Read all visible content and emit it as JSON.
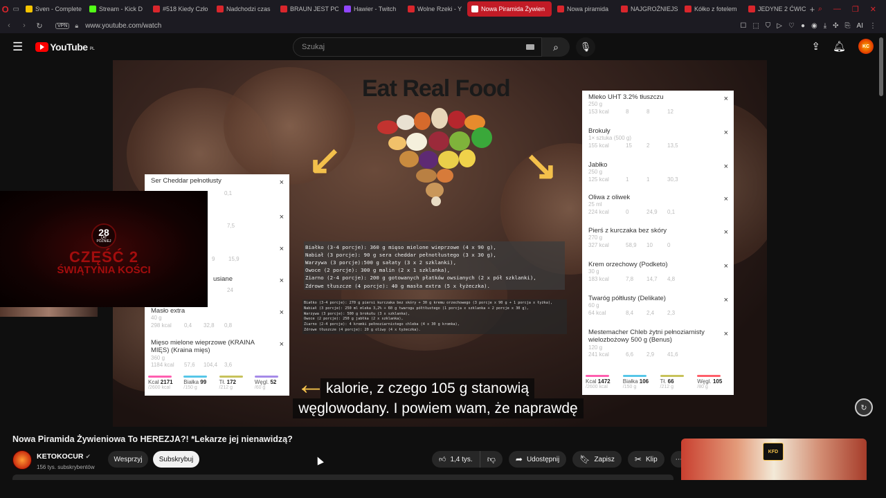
{
  "browser": {
    "tabs": [
      {
        "label": "Sven - Complete",
        "color": "#f5c400"
      },
      {
        "label": "Stream - Kick D",
        "color": "#53fc18"
      },
      {
        "label": "#518 Kiedy Czło",
        "color": "#d9262c"
      },
      {
        "label": "Nadchodzi czas",
        "color": "#d9262c"
      },
      {
        "label": "BRAUN JEST PO",
        "color": "#d9262c"
      },
      {
        "label": "Hawier - Twitch",
        "color": "#9146ff"
      },
      {
        "label": "Wolne Rzeki - Y",
        "color": "#d9262c"
      },
      {
        "label": "Nowa Piramida Żywien",
        "color": "#ffffff",
        "active": true
      },
      {
        "label": "Nowa piramida",
        "color": "#d9262c"
      },
      {
        "label": "NAJGROŹNIEJS",
        "color": "#d9262c"
      },
      {
        "label": "Kółko z fotelem",
        "color": "#d9262c"
      },
      {
        "label": "JEDYNE 2 ĆWIC",
        "color": "#d9262c"
      }
    ],
    "new_tab": "+",
    "vpn_label": "VPN",
    "url": "www.youtube.com/watch",
    "ai_label": "AI"
  },
  "header": {
    "logo_text": "YouTube",
    "region": "PL",
    "search_placeholder": "Szukaj",
    "avatar_text": "KC"
  },
  "video": {
    "title_overlay": "Eat Real Food",
    "diet_lines": [
      "Białko (3-4 porcje): 360 g mięso mielone wieprzowe (4 x 90 g),",
      "Nabiał (3 porcje): 90 g sera cheddar pełnotłustego (3 x 30 g),",
      "Warzywa (3 porcje):500 g sałaty (3 x 2 szklanki),",
      "Owoce (2 porcje): 300 g malin (2 x 1 szklanka),",
      "Ziarno (2-4 porcje): 200 g gotowanych płatków owsianych (2 x pół szklanki),",
      "Zdrowe tłuszcze (4 porcje): 40 g masła extra (5 x łyżeczka)."
    ],
    "diet_lines_small": [
      "Białko (3-4 porcje): 270 g piersi kurczaka bez skóry + 30 g kremu orzechowego (3 porcje x 90 g + 1 porcja x łyżka),",
      "Nabiał (3 porcje): 250 ml mleka 3,2% + 60 g twarogu półtłustego (1 porcja x szklanka + 2 porcje x 30 g),",
      "Warzywa (3 porcje): 500 g brokułu (3 x szklanka),",
      "Owoce (2 porcje): 250 g jabłka (2 x szklanka),",
      "Ziarno (2-4 porcje): 4 kromki pełnoziarnistego chleba (4 x 30 g kromka),",
      "Zdrowe tłuszcze (4 porcje): 20 g oliwy (4 x łyżeczka)."
    ],
    "left_panel": {
      "items": [
        {
          "name": "Ser Cheddar pełnotłusty",
          "sub": "",
          "vals": [
            "",
            "3,5",
            "0,1"
          ]
        },
        {
          "name": "",
          "sub": "",
          "vals": [
            "",
            "",
            "7,5"
          ]
        },
        {
          "name": "",
          "sub": "",
          "vals": [
            "",
            "9",
            "15,9"
          ]
        },
        {
          "name": "",
          "sub": "usiane",
          "vals": [
            "",
            "",
            "24"
          ]
        },
        {
          "name": "Masło extra",
          "sub": "40 g",
          "vals": [
            "298 kcal",
            "0,4",
            "32,8",
            "0,8"
          ]
        },
        {
          "name": "Mięso mielone wieprzowe (KRAINA MIĘS) (Kraina mięs)",
          "sub": "360 g",
          "vals": [
            "1184 kcal",
            "57,6",
            "104,4",
            "3,6"
          ]
        }
      ],
      "macros": [
        {
          "label": "Kcal",
          "value": "2171",
          "limit": "/2600 kcal",
          "color": "#ff5fb0"
        },
        {
          "label": "Białka",
          "value": "99",
          "limit": "/150 g",
          "color": "#56c6e8"
        },
        {
          "label": "Tł.",
          "value": "172",
          "limit": "/212 g",
          "color": "#c7c25a"
        },
        {
          "label": "Węgl.",
          "value": "52",
          "limit": "/60 g",
          "color": "#a58ae8"
        }
      ]
    },
    "right_panel": {
      "items": [
        {
          "name": "Mleko UHT 3.2% tłuszczu",
          "sub": "250 g",
          "vals": [
            "153 kcal",
            "8",
            "8",
            "12"
          ]
        },
        {
          "name": "Brokuły",
          "sub": "1× sztuka (500 g)",
          "vals": [
            "155 kcal",
            "15",
            "2",
            "13,5"
          ]
        },
        {
          "name": "Jabłko",
          "sub": "250 g",
          "vals": [
            "125 kcal",
            "1",
            "1",
            "30,3"
          ]
        },
        {
          "name": "Oliwa z oliwek",
          "sub": "25 ml",
          "vals": [
            "224 kcal",
            "0",
            "24,9",
            "0,1"
          ]
        },
        {
          "name": "Pierś z kurczaka bez skóry",
          "sub": "270 g",
          "vals": [
            "327 kcal",
            "58,9",
            "10",
            "0"
          ]
        },
        {
          "name": "Krem orzechowy (Podketo)",
          "sub": "30 g",
          "vals": [
            "183 kcal",
            "7,8",
            "14,7",
            "4,8"
          ]
        },
        {
          "name": "Twaróg półtłusty (Delikate)",
          "sub": "60 g",
          "vals": [
            "64 kcal",
            "8,4",
            "2,4",
            "2,3"
          ]
        },
        {
          "name": "Mestemacher Chleb żytni pełnoziarnisty wielozbożowy 500 g (Benus)",
          "sub": "120 g",
          "vals": [
            "241 kcal",
            "6,6",
            "2,9",
            "41,6"
          ]
        }
      ],
      "macros": [
        {
          "label": "Kcal",
          "value": "1472",
          "limit": "/2600 kcal",
          "color": "#ff5fb0"
        },
        {
          "label": "Białka",
          "value": "106",
          "limit": "/150 g",
          "color": "#56c6e8"
        },
        {
          "label": "Tł.",
          "value": "66",
          "limit": "/212 g",
          "color": "#c7c25a"
        },
        {
          "label": "Węgl.",
          "value": "105",
          "limit": "/80 g",
          "color": "#ff5f6a"
        }
      ]
    },
    "subtitle_line1": "kalorie, z czego 105 g stanowią",
    "subtitle_line2": "węglowodany. I powiem wam, że naprawdę",
    "close_symbol": "×"
  },
  "pip": {
    "number": "28",
    "small1": "LAT",
    "small2": "PÓŹNIEJ",
    "part": "CZĘŚĆ 2",
    "subtitle": "ŚWIĄTYNIA KOŚCI"
  },
  "meta": {
    "title": "Nowa Piramida Żywieniowa To HEREZJA?! *Lekarze jej nienawidzą?",
    "channel": "KETOKOCUR",
    "subscribers": "156 tys. subskrybentów",
    "support_label": "Wesprzyj",
    "subscribe_label": "Subskrybuj",
    "likes": "1,4 tys.",
    "share_label": "Udostępnij",
    "save_label": "Zapisz",
    "clip_label": "Klip",
    "more_label": "⋯"
  },
  "side": {
    "badge": "KFD"
  }
}
